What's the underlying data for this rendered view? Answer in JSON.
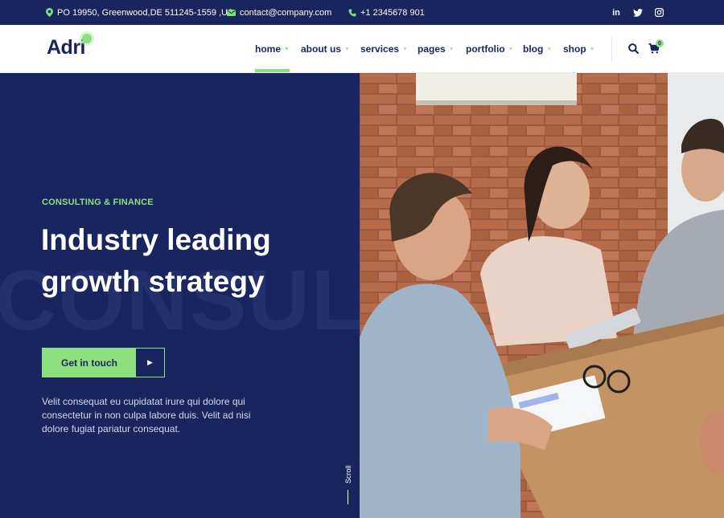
{
  "topbar": {
    "address": "PO 19950, Greenwood,DE 511245-1559 ,US",
    "email": "contact@company.com",
    "phone": "+1 2345678 901",
    "social": [
      "in",
      "twitter",
      "instagram"
    ]
  },
  "header": {
    "logo": "Adri",
    "nav": [
      {
        "label": "home",
        "active": true
      },
      {
        "label": "about us"
      },
      {
        "label": "services"
      },
      {
        "label": "pages"
      },
      {
        "label": "portfolio"
      },
      {
        "label": "blog"
      },
      {
        "label": "shop"
      }
    ],
    "cart_count": "0",
    "icons": [
      "search-icon",
      "cart-icon"
    ]
  },
  "hero": {
    "eyebrow": "CONSULTING & FINANCE",
    "title_line1": "Industry leading",
    "title_line2": "growth strategy",
    "watermark": "CONSULT",
    "cta_label": "Get in touch",
    "description": "Velit consequat eu cupidatat irure qui dolore qui consectetur in non culpa labore duis. Velit ad nisi dolore fugiat pariatur consequat.",
    "scroll_label": "Scroll"
  },
  "colors": {
    "navy": "#18255e",
    "accent_green": "#8ee07e",
    "white": "#ffffff"
  }
}
